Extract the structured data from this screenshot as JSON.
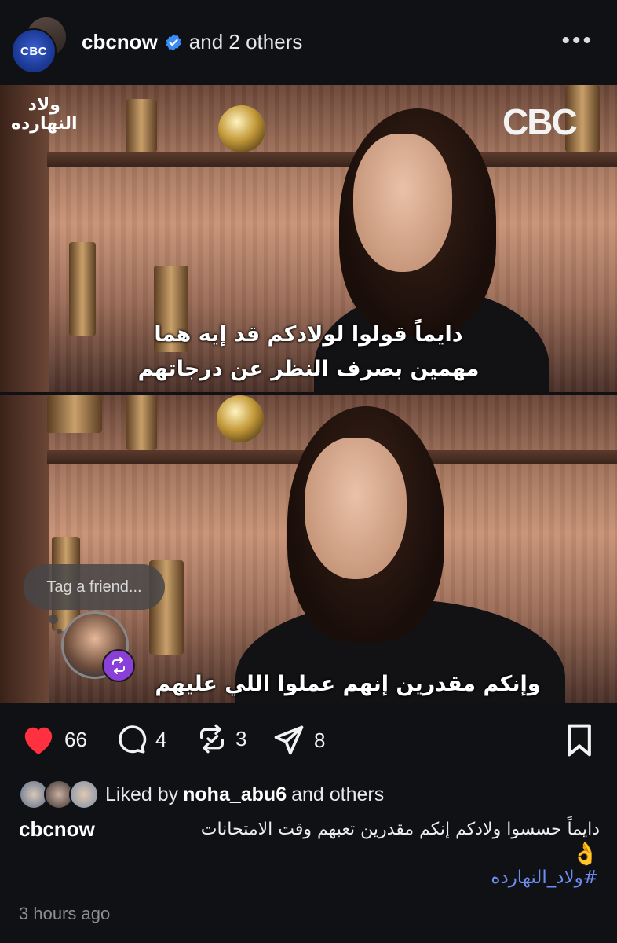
{
  "header": {
    "username": "cbcnow",
    "coauthors": "and 2 others",
    "avatar_text": "CBC"
  },
  "media": {
    "channel_logo": "CBC",
    "show_logo_line1": "ولاد",
    "show_logo_line2": "النهارده",
    "subtitle1_line1": "دايماً قولوا لولادكم قد إيه هما",
    "subtitle1_line2": "مهمين بصرف النظر عن درجاتهم",
    "subtitle2_line1": "وإنكم مقدرين إنهم عملوا اللي عليهم",
    "tag_placeholder": "Tag a friend..."
  },
  "actions": {
    "likes": "66",
    "comments": "4",
    "reposts": "3",
    "shares": "8"
  },
  "liked_by": {
    "prefix": "Liked by",
    "user": "noha_abu6",
    "suffix": "and others"
  },
  "caption": {
    "user": "cbcnow",
    "text": "دايماً حسسوا ولادكم إنكم مقدرين تعبهم وقت الامتحانات",
    "emoji": "👌",
    "hashtag": "#ولاد_النهارده"
  },
  "timestamp": "3 hours ago",
  "colors": {
    "background": "#0f1115",
    "heart": "#ff3040",
    "hashtag": "#6f8cf2",
    "repost_badge": "#8b3fd9"
  }
}
